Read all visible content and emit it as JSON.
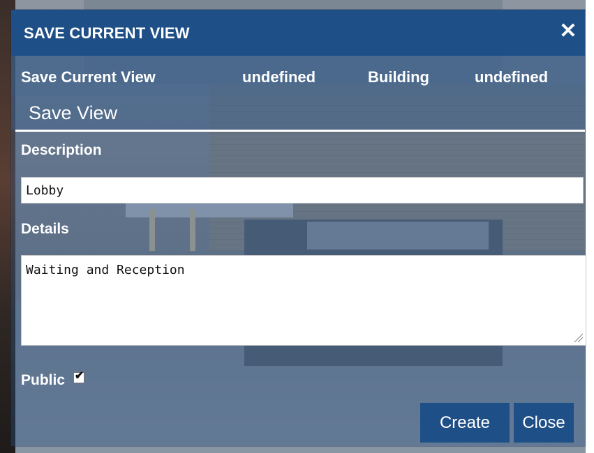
{
  "dialog": {
    "title": "SAVE CURRENT VIEW",
    "close_icon": "close-icon"
  },
  "info_bar": {
    "items": [
      "Save Current View",
      "undefined",
      "Building",
      "undefined"
    ]
  },
  "section": {
    "title": "Save View"
  },
  "form": {
    "description_label": "Description",
    "description_value": "Lobby",
    "details_label": "Details",
    "details_value": "Waiting and Reception",
    "public_label": "Public",
    "public_checked": true
  },
  "buttons": {
    "create": "Create",
    "close": "Close"
  },
  "colors": {
    "titlebar": "#1f4f87",
    "button": "#1f4f87"
  }
}
